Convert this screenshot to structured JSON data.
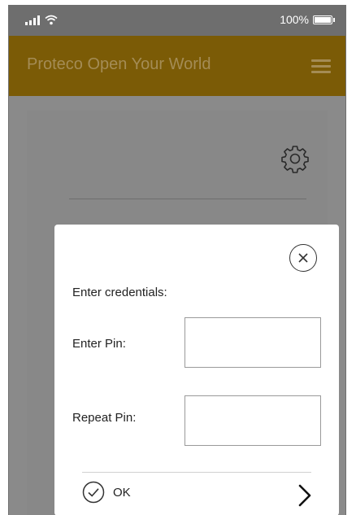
{
  "status_bar": {
    "battery_text": "100%"
  },
  "app_bar": {
    "title": "Proteco Open Your World"
  },
  "dialog": {
    "heading": "Enter credentials:",
    "fields": [
      {
        "label": "Enter Pin:",
        "value": "",
        "placeholder": ""
      },
      {
        "label": "Repeat Pin:",
        "value": "",
        "placeholder": ""
      }
    ],
    "ok_label": "OK"
  },
  "icons": {
    "signal": "signal-icon",
    "wifi": "wifi-icon",
    "battery": "battery-icon",
    "menu": "menu-icon",
    "settings": "gear-icon",
    "close": "close-icon",
    "ok": "check-circle-icon",
    "next": "chevron-right-icon"
  },
  "colors": {
    "app_bar": "#7b5b06",
    "app_bar_text": "#a48c55",
    "overlay": "#8a8a8a",
    "dialog": "#ffffff"
  }
}
